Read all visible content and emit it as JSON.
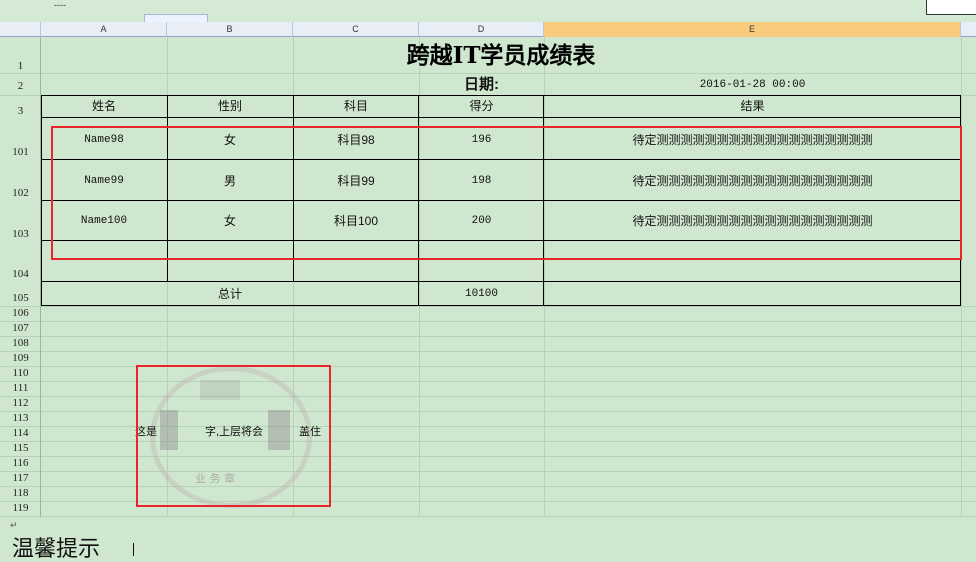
{
  "columns": [
    "A",
    "B",
    "C",
    "D",
    "E"
  ],
  "rows": [
    "1",
    "2",
    "3",
    "101",
    "102",
    "103",
    "104",
    "105",
    "106",
    "107",
    "108",
    "109",
    "110",
    "111",
    "112",
    "113",
    "114",
    "115",
    "116",
    "117",
    "118",
    "119"
  ],
  "title": "跨越IT学员成绩表",
  "date_label": "日期:",
  "date_value": "2016-01-28 00:00",
  "headers": [
    "姓名",
    "性别",
    "科目",
    "得分",
    "结果"
  ],
  "records": [
    {
      "name": "Name98",
      "gender": "女",
      "subject": "科目98",
      "score": "196",
      "result": "待定测测测测测测测测测测测测测测测测测测"
    },
    {
      "name": "Name99",
      "gender": "男",
      "subject": "科目99",
      "score": "198",
      "result": "待定测测测测测测测测测测测测测测测测测测"
    },
    {
      "name": "Name100",
      "gender": "女",
      "subject": "科目100",
      "score": "200",
      "result": "待定测测测测测测测测测测测测测测测测测测"
    }
  ],
  "total_label": "总计",
  "total_value": "10100",
  "overlay_text": "这是",
  "overlay_text2": "字,上层将会",
  "overlay_text3": "盖住",
  "seal_text": "业 务 章",
  "bottom_text": "温馨提示",
  "topstrip_text": "----",
  "return_symbol": "↵",
  "colors": {
    "background": "#cfe7cf",
    "highlight": "#e8262a",
    "selected_column": "#f9cc7d"
  }
}
